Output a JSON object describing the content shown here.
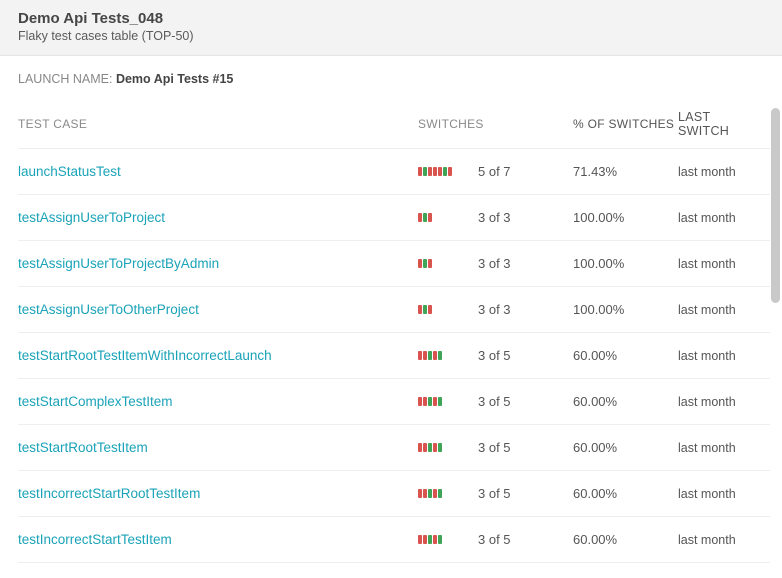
{
  "header": {
    "title": "Demo Api Tests_048",
    "subtitle": "Flaky test cases table (TOP-50)"
  },
  "launch": {
    "label": "LAUNCH NAME:",
    "value": "Demo Api Tests #15"
  },
  "columns": {
    "name": "TEST CASE",
    "switches": "SWITCHES",
    "percent": "% OF SWITCHES",
    "last": "LAST SWITCH"
  },
  "rows": [
    {
      "name": "launchStatusTest",
      "pattern": "rgrrrgr",
      "switches": "5 of 7",
      "percent": "71.43%",
      "last": "last month"
    },
    {
      "name": "testAssignUserToProject",
      "pattern": "rgr",
      "switches": "3 of 3",
      "percent": "100.00%",
      "last": "last month"
    },
    {
      "name": "testAssignUserToProjectByAdmin",
      "pattern": "rgr",
      "switches": "3 of 3",
      "percent": "100.00%",
      "last": "last month"
    },
    {
      "name": "testAssignUserToOtherProject",
      "pattern": "rgr",
      "switches": "3 of 3",
      "percent": "100.00%",
      "last": "last month"
    },
    {
      "name": "testStartRootTestItemWithIncorrectLaunch",
      "pattern": "rrgrg",
      "switches": "3 of 5",
      "percent": "60.00%",
      "last": "last month"
    },
    {
      "name": "testStartComplexTestItem",
      "pattern": "rrgrg",
      "switches": "3 of 5",
      "percent": "60.00%",
      "last": "last month"
    },
    {
      "name": "testStartRootTestItem",
      "pattern": "rrgrg",
      "switches": "3 of 5",
      "percent": "60.00%",
      "last": "last month"
    },
    {
      "name": "testIncorrectStartRootTestItem",
      "pattern": "rrgrg",
      "switches": "3 of 5",
      "percent": "60.00%",
      "last": "last month"
    },
    {
      "name": "testIncorrectStartTestItem",
      "pattern": "rrgrg",
      "switches": "3 of 5",
      "percent": "60.00%",
      "last": "last month"
    }
  ]
}
